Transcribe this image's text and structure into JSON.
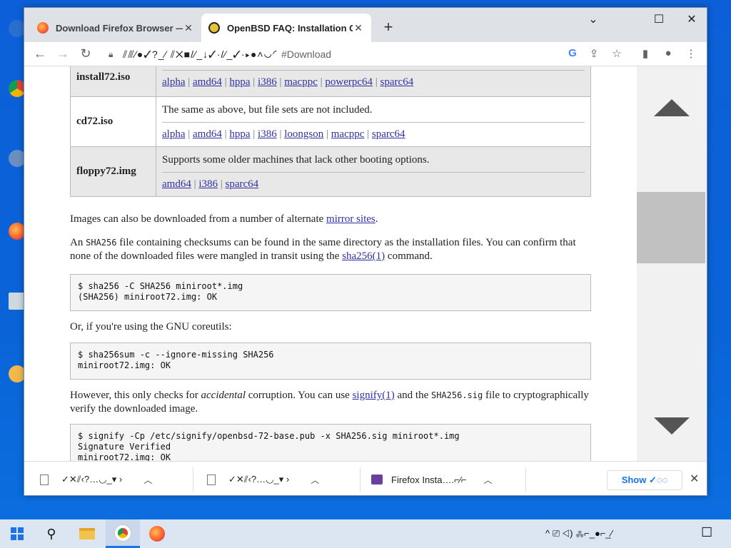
{
  "browser": {
    "tabs": [
      {
        "title": "Download Firefox Browser — ",
        "close": "✕"
      },
      {
        "title": "OpenBSD FAQ: Installation Gu",
        "close": "✕"
      }
    ],
    "new_tab": "+",
    "window_controls": {
      "minimize": "⌄",
      "restore": "☐",
      "close": "✕"
    },
    "address": {
      "url_garbled": "⫽⫻⁄●✓?_⁄ ⫽✕■/⁄_↓✓·/⁄_✓·▸●˄◡◜",
      "fragment": "#Download"
    }
  },
  "page": {
    "table_rows": [
      {
        "name": "install72.iso",
        "desc": "",
        "links": [
          "alpha",
          "amd64",
          "hppa",
          "i386",
          "macppc",
          "powerpc64",
          "sparc64"
        ]
      },
      {
        "name": "cd72.iso",
        "desc": "The same as above, but file sets are not included.",
        "links": [
          "alpha",
          "amd64",
          "hppa",
          "i386",
          "loongson",
          "macppc",
          "sparc64"
        ]
      },
      {
        "name": "floppy72.img",
        "desc": "Supports some older machines that lack other booting options.",
        "links": [
          "amd64",
          "i386",
          "sparc64"
        ]
      }
    ],
    "p1": {
      "before": "Images can also be downloaded from a number of alternate ",
      "link": "mirror sites",
      "after": "."
    },
    "p2": {
      "a": "An ",
      "code": "SHA256",
      "b": " file containing checksums can be found in the same directory as the installation files. You can confirm that none of the downloaded files were mangled in transit using the ",
      "link": "sha256(1)",
      "c": " command."
    },
    "code1": "$ sha256 -C SHA256 miniroot*.img\n(SHA256) miniroot72.img: OK",
    "p3": "Or, if you're using the GNU coreutils:",
    "code2": "$ sha256sum -c --ignore-missing SHA256\nminiroot72.img: OK",
    "p4": {
      "a": "However, this only checks for ",
      "em": "accidental",
      "b": " corruption. You can use ",
      "link": "signify(1)",
      "c": " and the ",
      "code": "SHA256.sig",
      "d": " file to cryptographically verify the downloaded image."
    },
    "code3": "$ signify -Cp /etc/signify/openbsd-72-base.pub -x SHA256.sig miniroot*.img\nSignature Verified\nminiroot72.img: OK"
  },
  "downloads": {
    "items": [
      {
        "label": "✓✕⫽‹?…◡_▾ ›"
      },
      {
        "label": "✓✕⫽‹?…◡_▾ ›"
      },
      {
        "label": "Firefox Insta….⌐⁄⌐"
      }
    ],
    "show_all": "Show ✓◌◌",
    "close": "✕"
  },
  "taskbar": {
    "tray_text": "^ ⎚ ◁) ⁂⌐_●⌐_⁄",
    "notification": "☐"
  },
  "colors": {
    "link": "#3030a0",
    "desktop_blue": "#0c5fd8",
    "accent": "#1a73e8"
  }
}
